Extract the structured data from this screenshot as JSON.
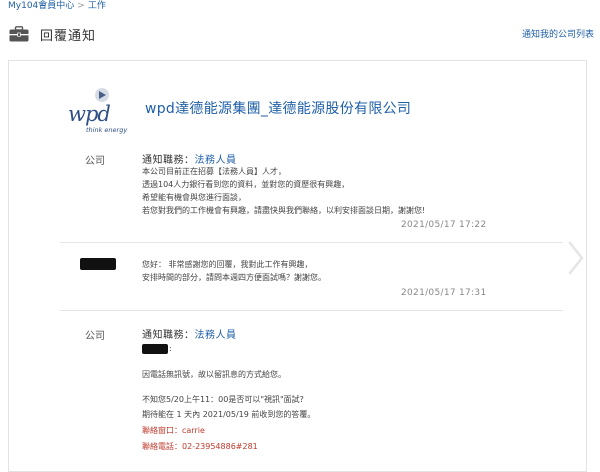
{
  "breadcrumb": {
    "root": "My104會員中心",
    "separator": ">",
    "current": "工作"
  },
  "header": {
    "title": "回覆通知",
    "link": "通知我的公司列表"
  },
  "company": {
    "logo_text": "wpd",
    "logo_tagline": "think energy",
    "name": "wpd達德能源集團_達德能源股份有限公司"
  },
  "messages": [
    {
      "sender": "公司",
      "title_prefix": "通知職務：",
      "job": "法務人員",
      "lines": [
        "本公司目前正在招募【法務人員】人才，",
        "透過104人力銀行看到您的資料，並對您的資歷很有興趣，",
        "希望能有機會與您進行面談，",
        "若您對我們的工作機會有興趣，請盡快與我們聯絡，以利安排面談日期，謝謝您!"
      ],
      "time": "2021/05/17 17:22"
    },
    {
      "sender": "",
      "lines": [
        "您好： 非常感謝您的回覆，我對此工作有興趣，",
        "安排時間的部分，請問本週四方便面試嗎？謝謝您。"
      ],
      "time": "2021/05/17 17:31"
    },
    {
      "sender": "公司",
      "title_prefix": "通知職務：",
      "job": "法務人員",
      "greeting_suffix": ":",
      "lines": [
        "因電話無訊號，故以留訊息的方式給您。",
        "",
        "不知您5/20上午11：00是否可以\"視訊\"面試?",
        "期待能在 1 天內 2021/05/19 前收到您的答覆。"
      ],
      "contact": [
        "聯絡窗口：carrie",
        "聯絡電話：02-23954886#281"
      ]
    }
  ],
  "colors": {
    "accent": "#1f5fa8",
    "contact": "#c0392b"
  },
  "icons": {
    "header": "briefcase-icon",
    "next": "chevron-right-icon"
  }
}
